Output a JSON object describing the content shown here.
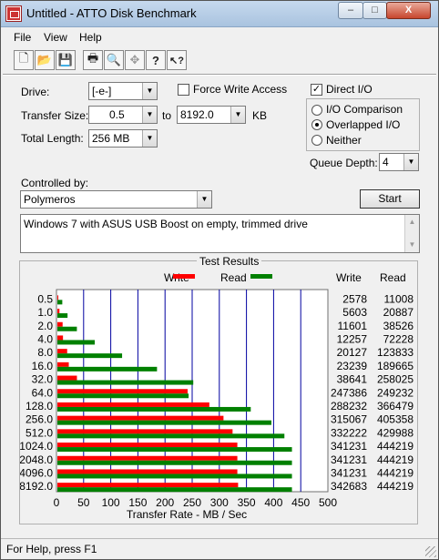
{
  "window": {
    "title": "Untitled - ATTO Disk Benchmark",
    "minimize": "–",
    "maximize": "□",
    "close": "X"
  },
  "menu": [
    "File",
    "View",
    "Help"
  ],
  "toolbar": [
    {
      "name": "new-icon",
      "glyph": "🗋"
    },
    {
      "name": "open-icon",
      "glyph": "📂"
    },
    {
      "name": "save-icon",
      "glyph": "💾"
    },
    {
      "name": "print-icon",
      "glyph": "🖶"
    },
    {
      "name": "print-preview-icon",
      "glyph": "🔍"
    },
    {
      "name": "move-icon",
      "glyph": "✥"
    },
    {
      "name": "help-icon",
      "glyph": "?"
    },
    {
      "name": "context-help-icon",
      "glyph": "↖?"
    }
  ],
  "form": {
    "drive_label": "Drive:",
    "drive_value": "[-e-]",
    "force_write_label": "Force Write Access",
    "direct_io_label": "Direct I/O",
    "direct_io_checked": "✓",
    "transfer_size_label": "Transfer Size:",
    "transfer_from": "0.5",
    "to_label": "to",
    "transfer_to": "8192.0",
    "kb_label": "KB",
    "total_length_label": "Total Length:",
    "total_length_value": "256 MB",
    "io_comparison": "I/O Comparison",
    "overlapped_io": "Overlapped I/O",
    "neither": "Neither",
    "queue_depth_label": "Queue Depth:",
    "queue_depth_value": "4",
    "controlled_by_label": "Controlled by:",
    "controlled_by_value": "Polymeros",
    "start_button": "Start",
    "description": "Windows 7 with ASUS USB Boost on empty, trimmed drive"
  },
  "results": {
    "title": "Test Results",
    "legend_write": "Write",
    "legend_read": "Read",
    "col_write": "Write",
    "col_read": "Read",
    "write_color": "#ff0000",
    "read_color": "#008000",
    "grid_color": "#0000a0"
  },
  "status": "For Help, press F1",
  "chart_data": {
    "type": "bar",
    "orientation": "horizontal",
    "title": "Test Results",
    "xlabel": "Transfer Rate - MB / Sec",
    "ylabel": "",
    "xlim": [
      0,
      500
    ],
    "xticks": [
      0,
      50,
      100,
      150,
      200,
      250,
      300,
      350,
      400,
      450,
      500
    ],
    "categories": [
      "0.5",
      "1.0",
      "2.0",
      "4.0",
      "8.0",
      "16.0",
      "32.0",
      "64.0",
      "128.0",
      "256.0",
      "512.0",
      "1024.0",
      "2048.0",
      "4096.0",
      "8192.0"
    ],
    "series": [
      {
        "name": "Write",
        "values": [
          2.5,
          5.5,
          11.3,
          12.0,
          19.7,
          22.7,
          37.7,
          241.6,
          281.6,
          307.7,
          324.4,
          333.2,
          333.2,
          333.2,
          334.6
        ]
      },
      {
        "name": "Read",
        "values": [
          10.7,
          20.4,
          37.6,
          70.5,
          120.9,
          185.2,
          252.0,
          243.4,
          357.9,
          395.9,
          419.9,
          433.8,
          433.8,
          433.8,
          433.8
        ]
      }
    ],
    "write_values_kb": [
      "2578",
      "5603",
      "11601",
      "12257",
      "20127",
      "23239",
      "38641",
      "247386",
      "288232",
      "315067",
      "332222",
      "341231",
      "341231",
      "341231",
      "342683"
    ],
    "read_values_kb": [
      "11008",
      "20887",
      "38526",
      "72228",
      "123833",
      "189665",
      "258025",
      "249232",
      "366479",
      "405358",
      "429988",
      "444219",
      "444219",
      "444219",
      "444219"
    ],
    "legend": "top"
  }
}
